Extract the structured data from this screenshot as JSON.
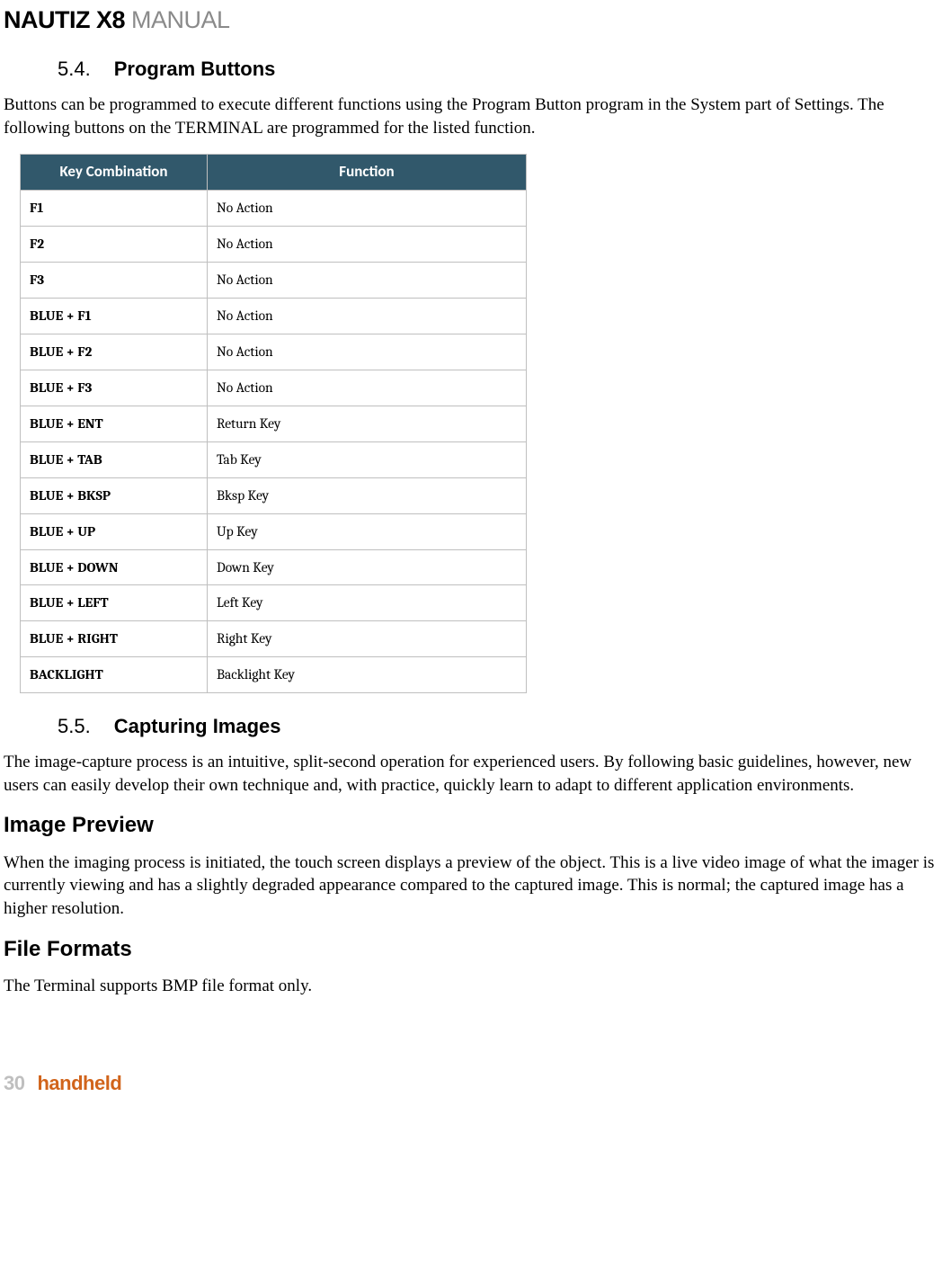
{
  "header": {
    "product": "NAUTIZ X8",
    "suffix": " MANUAL"
  },
  "sections": [
    {
      "num": "5.4.",
      "title": "Program Buttons",
      "intro": "Buttons can be programmed to execute different functions using the Program Button program in the System part of Settings. The following buttons on the TERMINAL are programmed for the listed function.",
      "table": {
        "headers": [
          "Key Combination",
          "Function"
        ],
        "rows": [
          {
            "key": "F1",
            "func": "No Action"
          },
          {
            "key": "F2",
            "func": "No Action"
          },
          {
            "key": "F3",
            "func": "No Action"
          },
          {
            "key": "BLUE + F1",
            "func": "No Action"
          },
          {
            "key": "BLUE + F2",
            "func": "No Action"
          },
          {
            "key": "BLUE + F3",
            "func": "No Action"
          },
          {
            "key": "BLUE + ENT",
            "func": "Return Key"
          },
          {
            "key": "BLUE + TAB",
            "func": "Tab Key"
          },
          {
            "key": "BLUE + BKSP",
            "func": "Bksp Key"
          },
          {
            "key": "BLUE + UP",
            "func": "Up Key"
          },
          {
            "key": "BLUE + DOWN",
            "func": "Down Key"
          },
          {
            "key": "BLUE + LEFT",
            "func": "Left Key"
          },
          {
            "key": "BLUE + RIGHT",
            "func": "Right Key"
          },
          {
            "key": "BACKLIGHT",
            "func": "Backlight Key"
          }
        ]
      }
    },
    {
      "num": "5.5.",
      "title": "Capturing Images",
      "intro": "The image-capture process is an intuitive, split-second operation for experienced users. By following basic guidelines, however, new users can easily develop their own technique and, with practice, quickly learn to adapt to different application environments.",
      "subs": [
        {
          "heading": "Image Preview",
          "body": "When the imaging process is initiated, the touch screen displays a preview of the object. This is a live video image of what the imager is currently viewing and has a slightly degraded appearance compared to the captured image. This is normal; the captured image has a higher resolution."
        },
        {
          "heading": "File Formats",
          "body": "The Terminal supports BMP file format only."
        }
      ]
    }
  ],
  "footer": {
    "page": "30",
    "brand": "handheld"
  }
}
